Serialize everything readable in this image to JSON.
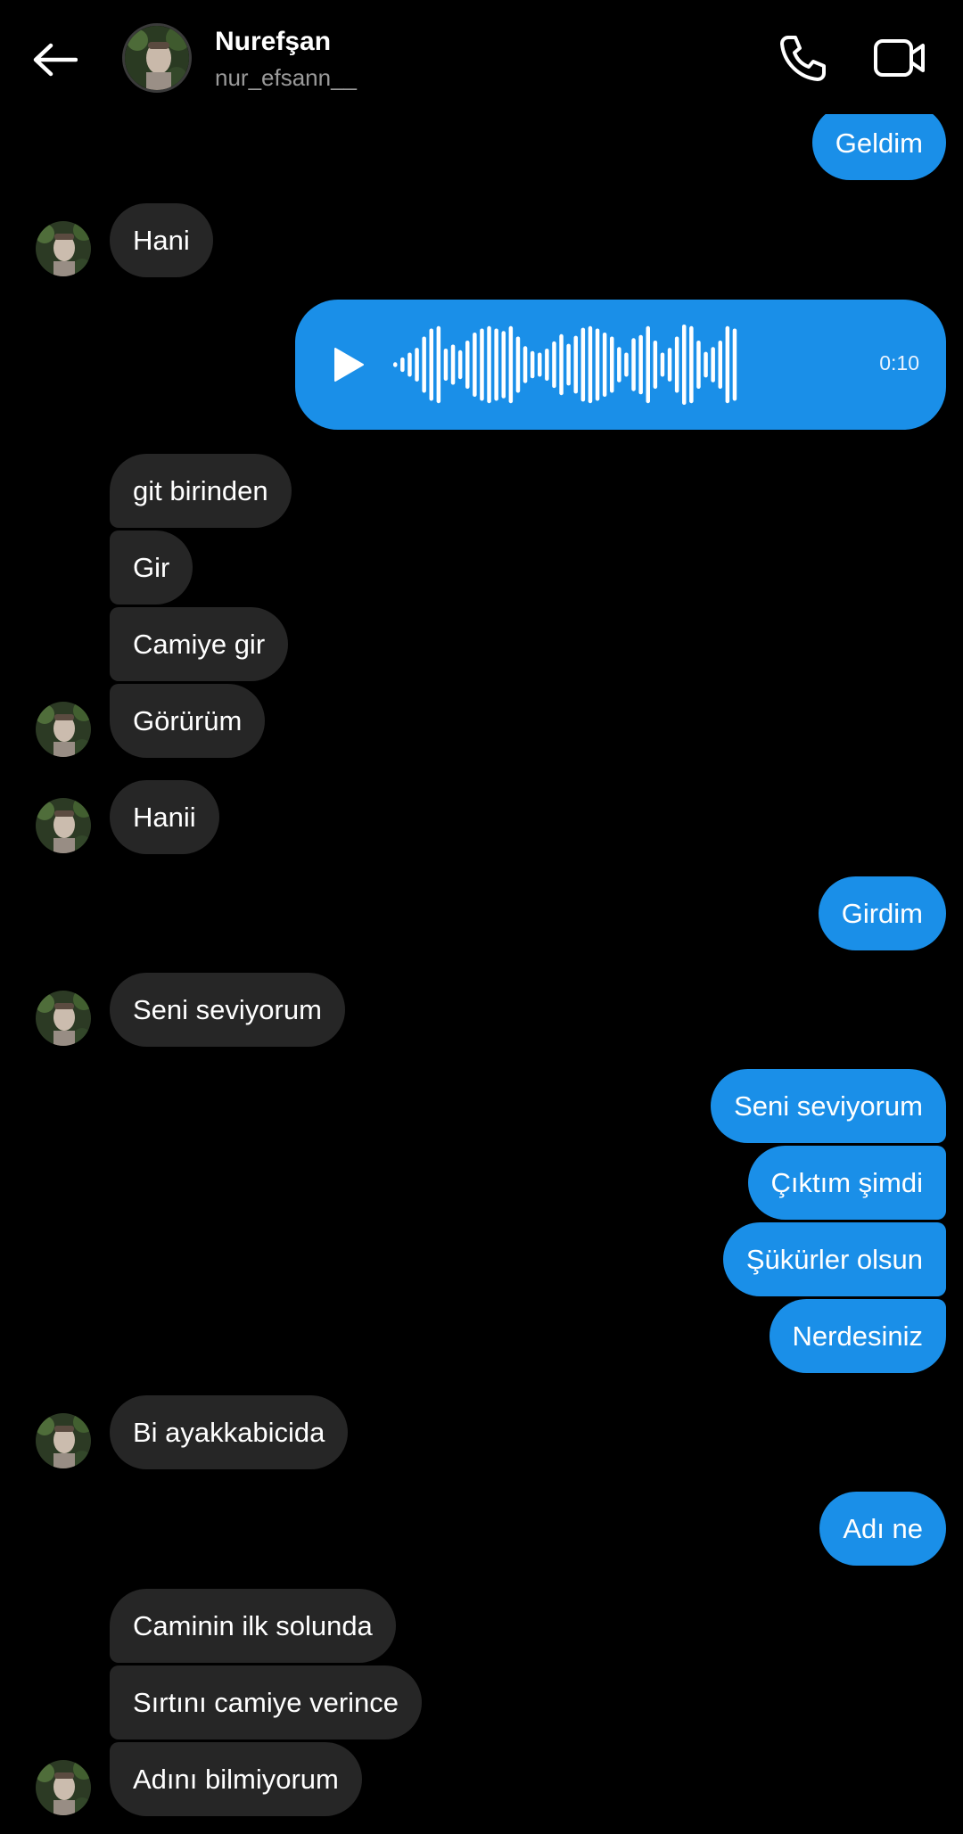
{
  "header": {
    "name": "Nurefşan",
    "username": "nur_efsann__"
  },
  "messages": [
    {
      "text": "Geldim"
    },
    {
      "text": "Hani"
    },
    {
      "text": "git birinden"
    },
    {
      "text": "Gir"
    },
    {
      "text": "Camiye gir"
    },
    {
      "text": "Görürüm"
    },
    {
      "text": "Hanii"
    },
    {
      "text": "Girdim"
    },
    {
      "text": "Seni seviyorum"
    },
    {
      "text": "Seni seviyorum"
    },
    {
      "text": "Çıktım şimdi"
    },
    {
      "text": "Şükürler olsun"
    },
    {
      "text": "Nerdesiniz"
    },
    {
      "text": "Bi ayakkabicida"
    },
    {
      "text": "Adı ne"
    },
    {
      "text": "Caminin ilk solunda"
    },
    {
      "text": "Sırtını camiye verince"
    },
    {
      "text": "Adını bilmiyorum"
    }
  ],
  "voice_message": {
    "duration": "0:10"
  },
  "icons": {
    "back": "arrow-left-icon",
    "call": "phone-icon",
    "video": "video-camera-icon",
    "play": "play-icon"
  },
  "colors": {
    "background": "#000000",
    "incoming_bubble": "#262626",
    "outgoing_bubble": "#1a8fe8",
    "secondary_text": "#9a9a9a"
  }
}
